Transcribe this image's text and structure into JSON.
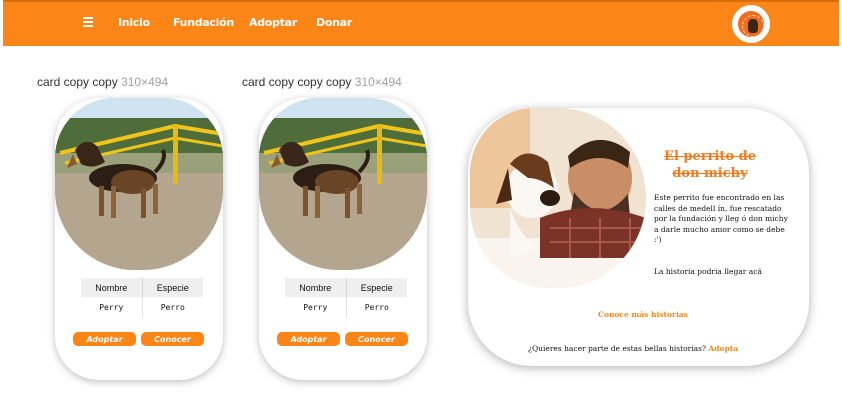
{
  "nav": {
    "items": [
      "Inicio",
      "Fundación",
      "Adoptar",
      "Donar"
    ]
  },
  "artboards": [
    {
      "name": "card copy copy",
      "size": "310×494"
    },
    {
      "name": "card copy copy copy",
      "size": "310×494"
    }
  ],
  "cards": [
    {
      "headers": [
        "Nombre",
        "Especie"
      ],
      "values": [
        "Perry",
        "Perro"
      ],
      "buttons": [
        "Adoptar",
        "Conocer"
      ]
    },
    {
      "headers": [
        "Nombre",
        "Especie"
      ],
      "values": [
        "Perry",
        "Perro"
      ],
      "buttons": [
        "Adoptar",
        "Conocer"
      ]
    }
  ],
  "story": {
    "title": "El perrito de don michy",
    "body": "Este perrito fue encontrado en las calles de medell ín, fue rescatado por la fundación y lleg ó don michy a darle mucho amor como se debe :')",
    "note": "La historia podria llegar acá",
    "link": "Conoce más historias",
    "cta": "¿Quieres hacer parte de estas bellas historias?",
    "cta_link": "Adopta"
  },
  "colors": {
    "accent": "#fb8517",
    "title": "#f47a20"
  },
  "icons": {
    "menu": "hamburger-menu-icon",
    "logo": "foundation-logo"
  }
}
